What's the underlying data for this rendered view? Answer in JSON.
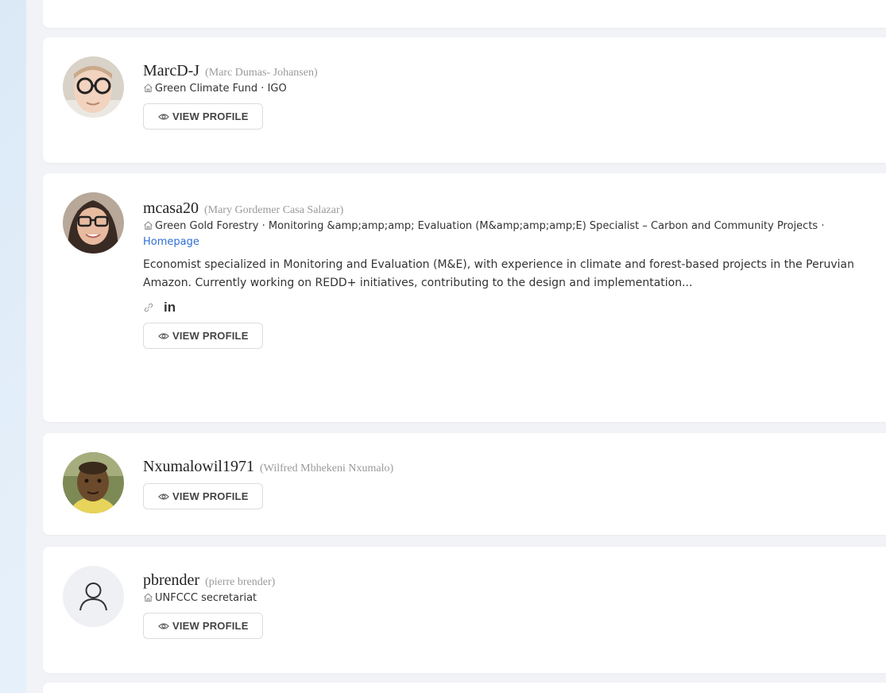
{
  "members": [
    {
      "username": "MarcD-J",
      "real_name": "(Marc Dumas- Johansen)",
      "organization": "Green Climate Fund",
      "sep1": " · ",
      "org_type": "IGO",
      "button_label": "VIEW PROFILE",
      "avatar_icon": "photo-avatar"
    },
    {
      "username": "mcasa20",
      "real_name": "(Mary Gordemer Casa Salazar)",
      "organization": "Green Gold Forestry",
      "sep1": " · ",
      "position": "Monitoring &amp;amp;amp; Evaluation (M&amp;amp;amp;E) Specialist – Carbon and Community Projects",
      "sep2": " · ",
      "homepage_label": "Homepage",
      "bio": "Economist specialized in Monitoring and Evaluation (M&E), with experience in climate and forest-based projects in the Peruvian Amazon. Currently working on REDD+ initiatives, contributing to the design and implementation...",
      "linkedin_label": "in",
      "button_label": "VIEW PROFILE",
      "avatar_icon": "photo-avatar"
    },
    {
      "username": "Nxumalowil1971",
      "real_name": "(Wilfred Mbhekeni Nxumalo)",
      "button_label": "VIEW PROFILE",
      "avatar_icon": "photo-avatar"
    },
    {
      "username": "pbrender",
      "real_name": "(pierre brender)",
      "organization": "UNFCCC secretariat",
      "button_label": "VIEW PROFILE",
      "avatar_icon": "user-placeholder-icon"
    }
  ],
  "colors": {
    "link": "#2d6fd6",
    "card_bg": "#ffffff",
    "panel_bg": "#f1f3f6"
  }
}
